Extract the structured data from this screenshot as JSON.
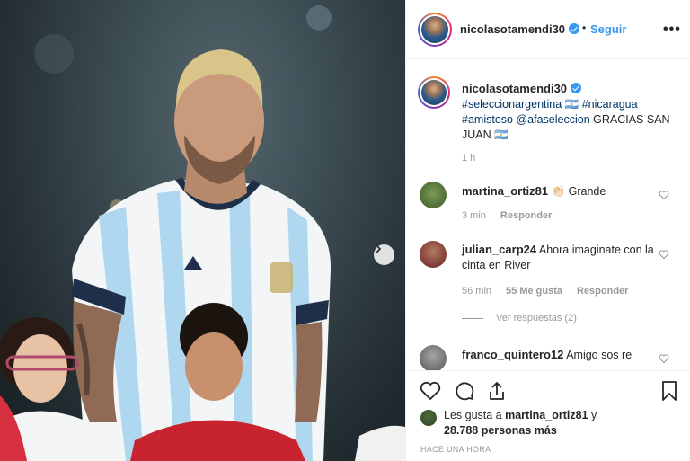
{
  "post": {
    "username": "nicolasotamendi30",
    "follow_label": "Seguir",
    "more_label": "•••",
    "separator": "•",
    "caption_parts": {
      "tag1": "#seleccionargentina",
      "flag1": " 🇦🇷 ",
      "tag2": "#nicaragua",
      "tag3": "#amistoso",
      "mention": "@afaseleccion",
      "text": " GRACIAS SAN JUAN ",
      "flag2": "🇦🇷"
    },
    "caption_time": "1 h"
  },
  "comments": [
    {
      "username": "martina_ortiz81",
      "text": " 👏🏻 Grande",
      "time": "3 min",
      "reply_label": "Responder",
      "likes": ""
    },
    {
      "username": "julian_carp24",
      "text": " Ahora imaginate con la cinta en River",
      "time": "56 min",
      "likes": "55 Me gusta",
      "reply_label": "Responder",
      "view_replies": "Ver respuestas (2)"
    },
    {
      "username": "franco_quintero12",
      "text": " Amigo sos re"
    }
  ],
  "footer": {
    "likes_prefix": "Les gusta a ",
    "likes_user": "martina_ortiz81",
    "likes_middle": " y ",
    "likes_count": "28.788 personas más",
    "timestamp": "HACE UNA HORA"
  },
  "icons": {
    "like": "heart-icon",
    "comment": "comment-icon",
    "share": "share-icon",
    "save": "bookmark-icon",
    "next": "chevron-right-icon",
    "verified": "verified-badge-icon"
  },
  "colors": {
    "link": "#3897f0",
    "tag": "#003569",
    "muted": "#999999",
    "verified": "#3897f0"
  }
}
